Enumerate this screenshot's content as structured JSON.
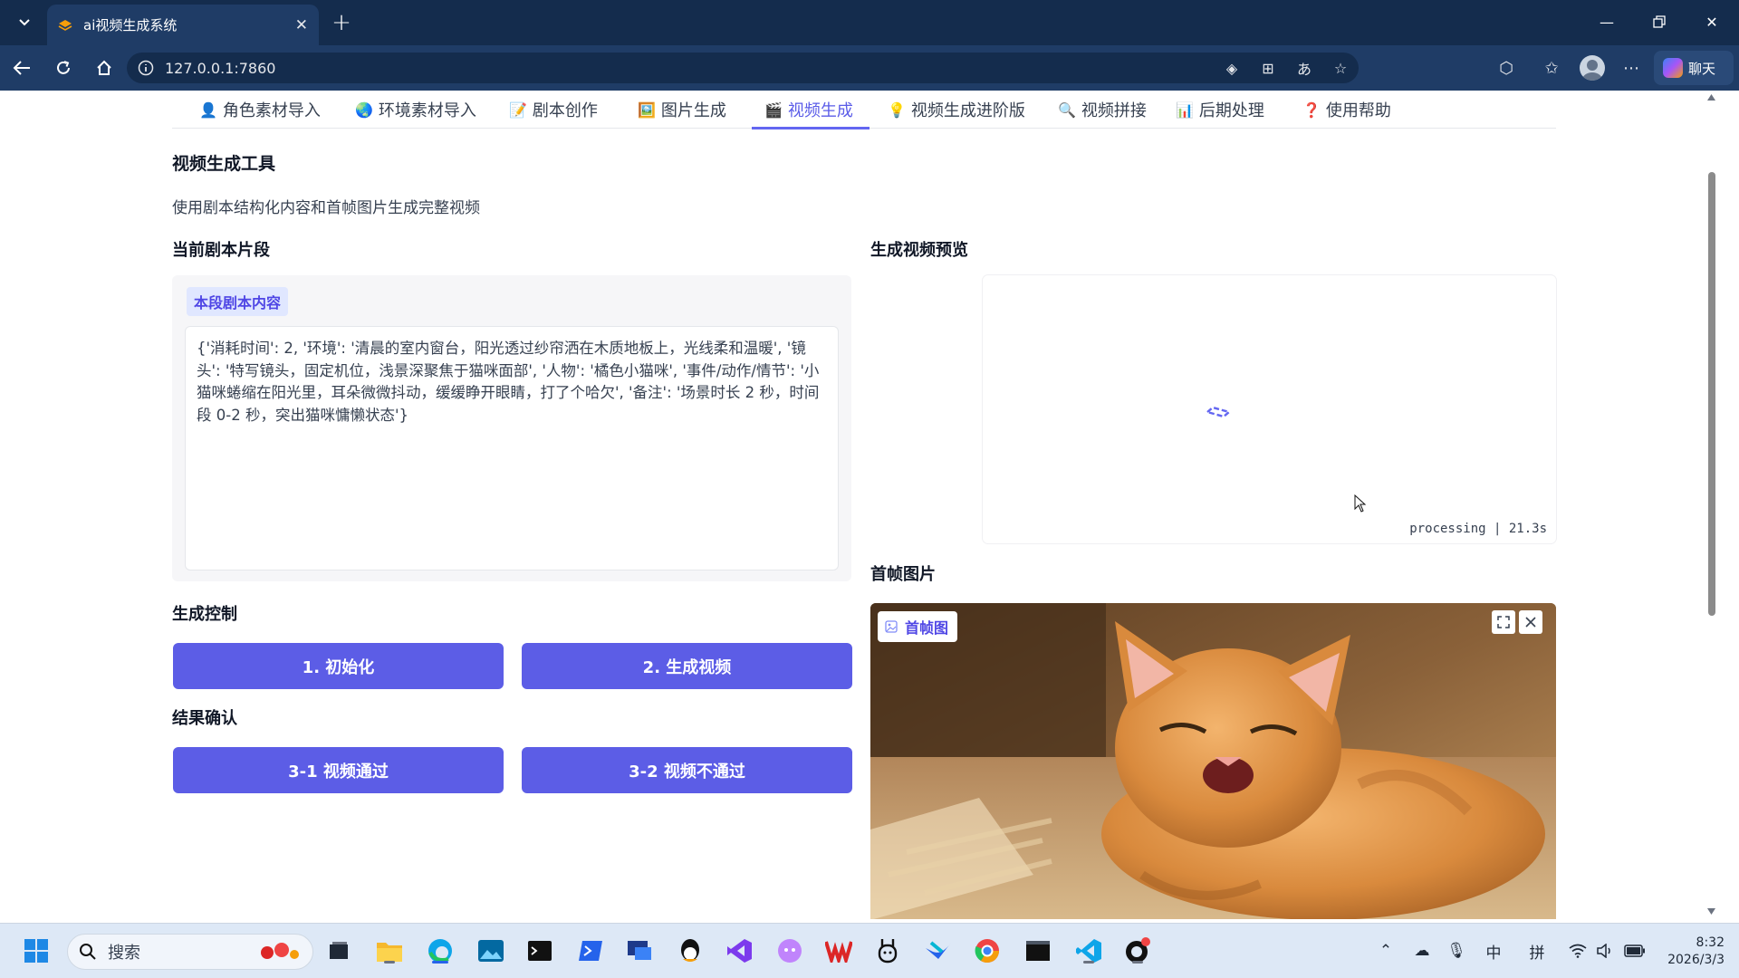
{
  "browser": {
    "tab_title": "ai视频生成系统",
    "url": "127.0.0.1:7860",
    "copilot_label": "聊天"
  },
  "app": {
    "tabs": [
      {
        "icon": "👤",
        "label": "角色素材导入"
      },
      {
        "icon": "🌏",
        "label": "环境素材导入"
      },
      {
        "icon": "📝",
        "label": "剧本创作"
      },
      {
        "icon": "🖼️",
        "label": "图片生成"
      },
      {
        "icon": "🎬",
        "label": "视频生成"
      },
      {
        "icon": "💡",
        "label": "视频生成进阶版"
      },
      {
        "icon": "🔍",
        "label": "视频拼接"
      },
      {
        "icon": "📊",
        "label": "后期处理"
      },
      {
        "icon": "❓",
        "label": "使用帮助"
      }
    ],
    "active_tab": "视频生成",
    "title": "视频生成工具",
    "description": "使用剧本结构化内容和首帧图片生成完整视频",
    "script_section": {
      "heading": "当前剧本片段",
      "label": "本段剧本内容",
      "content": "{'消耗时间': 2, '环境': '清晨的室内窗台，阳光透过纱帘洒在木质地板上，光线柔和温暖', '镜头': '特写镜头，固定机位，浅景深聚焦于猫咪面部', '人物': '橘色小猫咪', '事件/动作/情节': '小猫咪蜷缩在阳光里，耳朵微微抖动，缓缓睁开眼睛，打了个哈欠', '备注': '场景时长 2 秒，时间段 0-2 秒，突出猫咪慵懒状态'}"
    },
    "control_section": {
      "heading": "生成控制",
      "init_button": "1. 初始化",
      "generate_button": "2. 生成视频"
    },
    "confirm_section": {
      "heading": "结果确认",
      "pass_button": "3-1 视频通过",
      "fail_button": "3-2 视频不通过"
    },
    "preview_section": {
      "heading": "生成视频预览",
      "status": "processing | 21.3s"
    },
    "first_frame_section": {
      "heading": "首帧图片",
      "badge": "首帧图"
    }
  },
  "taskbar": {
    "search_placeholder": "搜索",
    "ime_lang": "中",
    "ime_mode": "拼",
    "time": "8:32",
    "date": "2026/3/3"
  },
  "colors": {
    "accent": "#5c5de6",
    "titlebar": "#142c4d",
    "toolbar": "#1f3c66"
  }
}
